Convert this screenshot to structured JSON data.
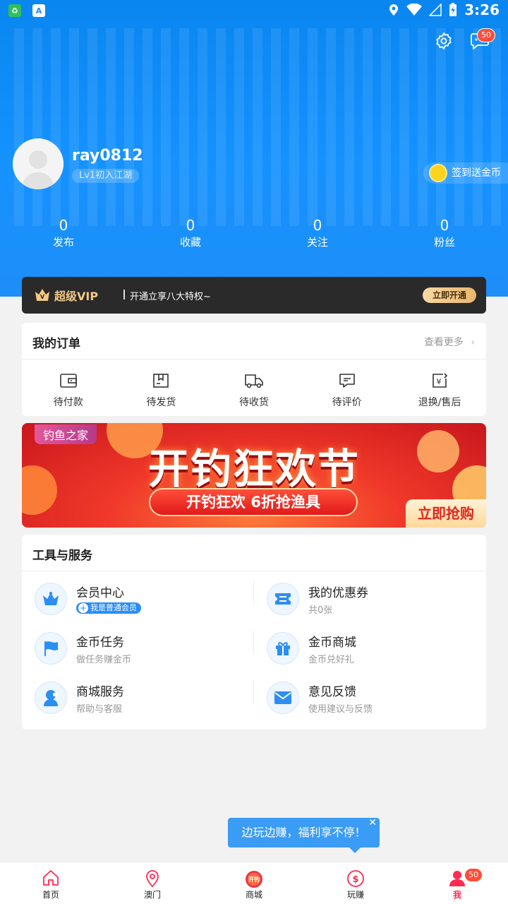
{
  "status_bar": {
    "time": "3:26",
    "notif_icon_label": "A"
  },
  "header": {
    "message_badge": "50"
  },
  "profile": {
    "username": "ray0812",
    "level": "Lv1初入江湖",
    "signin_label": "签到送金币"
  },
  "stats": [
    {
      "count": "0",
      "label": "发布"
    },
    {
      "count": "0",
      "label": "收藏"
    },
    {
      "count": "0",
      "label": "关注"
    },
    {
      "count": "0",
      "label": "粉丝"
    }
  ],
  "vip": {
    "title": "超级VIP",
    "desc": "开通立享八大特权~",
    "button": "立即开通"
  },
  "orders": {
    "title": "我的订单",
    "more": "查看更多",
    "items": [
      {
        "label": "待付款",
        "icon": "wallet-icon"
      },
      {
        "label": "待发货",
        "icon": "box-icon"
      },
      {
        "label": "待收货",
        "icon": "truck-icon"
      },
      {
        "label": "待评价",
        "icon": "comment-icon"
      },
      {
        "label": "退换/售后",
        "icon": "refund-icon"
      }
    ]
  },
  "banner": {
    "tag": "钓鱼之家",
    "headline": "开钓狂欢节",
    "subline": "开钓狂欢  6折抢渔具",
    "cta": "立即抢购"
  },
  "tools": {
    "title": "工具与服务",
    "items": [
      {
        "title": "会员中心",
        "subtitle": "我是普通会员",
        "icon": "crown-icon"
      },
      {
        "title": "我的优惠券",
        "subtitle": "共0张",
        "icon": "ticket-icon"
      },
      {
        "title": "金币任务",
        "subtitle": "做任务赚金币",
        "icon": "flag-icon"
      },
      {
        "title": "金币商城",
        "subtitle": "金币兑好礼",
        "icon": "gift-icon"
      },
      {
        "title": "商城服务",
        "subtitle": "帮助与客服",
        "icon": "service-icon"
      },
      {
        "title": "意见反馈",
        "subtitle": "使用建议与反馈",
        "icon": "mail-icon"
      }
    ]
  },
  "toast": {
    "text": "边玩边赚，福利享不停！",
    "close": "✕"
  },
  "tabbar": {
    "items": [
      {
        "label": "首页",
        "icon": "home-icon"
      },
      {
        "label": "澳门",
        "icon": "location-icon"
      },
      {
        "label": "商城",
        "icon": "shop-icon",
        "icon_text": "开钓"
      },
      {
        "label": "玩赚",
        "icon": "earn-icon"
      },
      {
        "label": "我",
        "icon": "me-icon",
        "badge": "50"
      }
    ]
  },
  "colors": {
    "primary": "#1592ff",
    "accent": "#ff2a52",
    "vip_gold": "#f3c984",
    "banner_red": "#f0382a"
  }
}
